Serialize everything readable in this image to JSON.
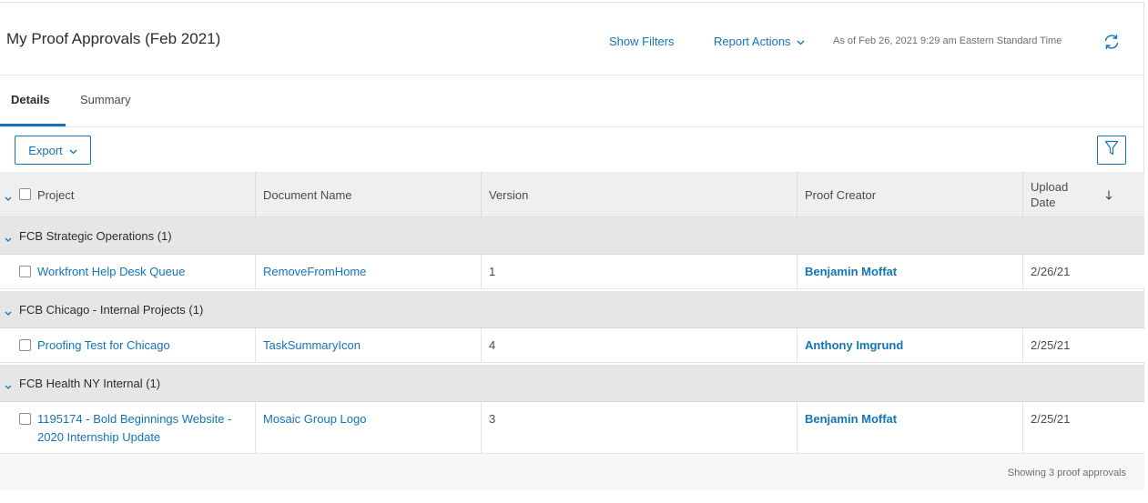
{
  "header": {
    "title": "My Proof Approvals (Feb 2021)",
    "show_filters": "Show Filters",
    "report_actions": "Report Actions",
    "as_of": "As of Feb 26, 2021 9:29 am Eastern Standard Time",
    "refresh_icon": "refresh-icon"
  },
  "tabs": [
    {
      "label": "Details",
      "active": true
    },
    {
      "label": "Summary",
      "active": false
    }
  ],
  "toolbar": {
    "export_label": "Export",
    "filter_icon": "filter-icon"
  },
  "table": {
    "columns": [
      "Project",
      "Document Name",
      "Version",
      "Proof Creator",
      "Upload Date"
    ],
    "sort": {
      "column": "Upload Date",
      "direction": "descending"
    },
    "groups": [
      {
        "label": "FCB Strategic Operations (1)",
        "rows": [
          {
            "project": "Workfront Help Desk Queue",
            "document": "RemoveFromHome",
            "version": "1",
            "creator": "Benjamin Moffat",
            "date": "2/26/21"
          }
        ]
      },
      {
        "label": "FCB Chicago - Internal Projects (1)",
        "rows": [
          {
            "project": "Proofing Test for Chicago",
            "document": "TaskSummaryIcon",
            "version": "4",
            "creator": "Anthony Imgrund",
            "date": "2/25/21"
          }
        ]
      },
      {
        "label": "FCB Health NY Internal (1)",
        "rows": [
          {
            "project_line1": "1195174 - Bold Beginnings Website -",
            "project_line2": "2020 Internship Update",
            "document": "Mosaic Group Logo",
            "version": "3",
            "creator": "Benjamin Moffat",
            "date": "2/25/21"
          }
        ]
      }
    ]
  },
  "footer": {
    "showing": "Showing 3 proof approvals"
  },
  "colors": {
    "accent": "#1474b8",
    "group_bg": "#e6e6e6",
    "header_bg": "#efefef"
  }
}
